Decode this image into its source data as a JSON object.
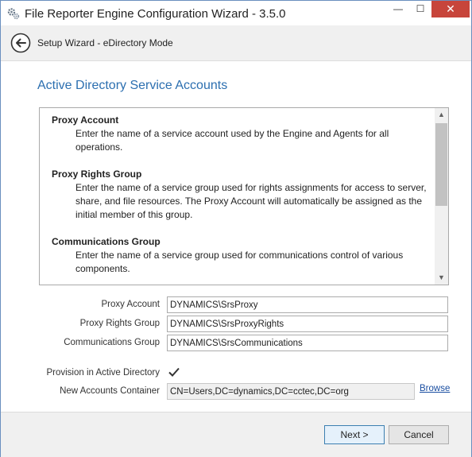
{
  "window": {
    "title": "File Reporter Engine Configuration Wizard - 3.5.0",
    "min_glyph": "—",
    "max_glyph": "☐",
    "close_glyph": "✕"
  },
  "nav": {
    "title": "Setup Wizard - eDirectory Mode"
  },
  "page": {
    "heading": "Active Directory Service Accounts"
  },
  "info": {
    "sections": [
      {
        "title": "Proxy Account",
        "desc": "Enter the name of a service account used by the Engine and Agents for all operations."
      },
      {
        "title": "Proxy Rights Group",
        "desc": "Enter the name of a service group used for rights assignments for access to server, share, and file resources.  The Proxy Account will automatically be assigned as the initial member of this group."
      },
      {
        "title": "Communications Group",
        "desc": "Enter the name of a service group used for communications control of various components."
      }
    ]
  },
  "form": {
    "proxy_account_label": "Proxy Account",
    "proxy_account_value": "DYNAMICS\\SrsProxy",
    "proxy_rights_label": "Proxy Rights Group",
    "proxy_rights_value": "DYNAMICS\\SrsProxyRights",
    "comm_group_label": "Communications Group",
    "comm_group_value": "DYNAMICS\\SrsCommunications",
    "provision_label": "Provision in Active Directory",
    "provision_checked": true,
    "container_label": "New Accounts Container",
    "container_value": "CN=Users,DC=dynamics,DC=cctec,DC=org",
    "browse_label": "Browse"
  },
  "footer": {
    "next_label": "Next >",
    "cancel_label": "Cancel"
  },
  "colors": {
    "heading": "#2c6fb0",
    "close": "#c7453b",
    "link": "#1a4ea1"
  }
}
